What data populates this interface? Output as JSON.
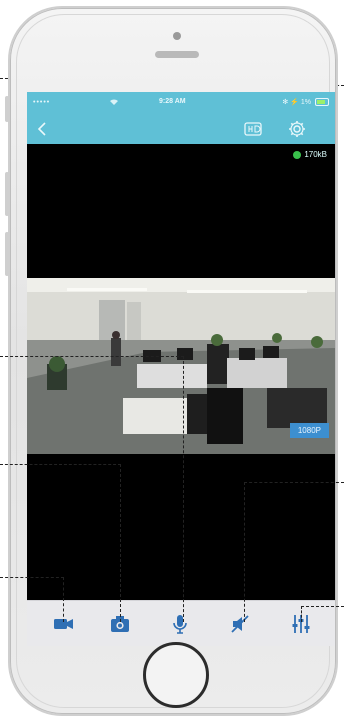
{
  "status_bar": {
    "signal": "•••••",
    "time": "9:28 AM",
    "right_icons": "✻ ⚡ 1%"
  },
  "nav": {
    "back_icon": "chevron-left-icon",
    "hd_icon": "hd-quality-icon",
    "settings_icon": "gear-icon"
  },
  "stream": {
    "bitrate": "170kB",
    "resolution": "1080P"
  },
  "toolbar": {
    "items": [
      "video-record-icon",
      "camera-snapshot-icon",
      "microphone-icon",
      "speaker-mute-icon",
      "equalizer-icon"
    ]
  },
  "colors": {
    "accent": "#5fc0d6",
    "status_ok": "#39c04c",
    "resolution_badge": "#3d8fd0",
    "toolbar_icon": "#2f6fb4"
  }
}
